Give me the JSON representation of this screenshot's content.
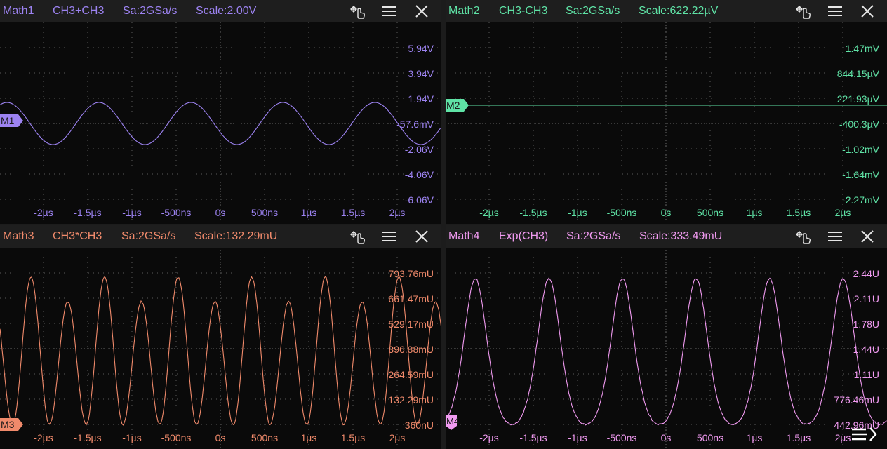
{
  "panels": [
    {
      "id": "m1",
      "name": "Math1",
      "expr": "CH3+CH3",
      "sample": "Sa:2GSa/s",
      "scale": "Scale:2.00V",
      "color": "#9d83f2",
      "marker": "M1",
      "yticks": [
        "5.94V",
        "3.94V",
        "1.94V",
        "-57.6mV",
        "-2.06V",
        "-4.06V",
        "-6.06V"
      ],
      "xticks": [
        "-2µs",
        "-1.5µs",
        "-1µs",
        "-500ns",
        "0s",
        "500ns",
        "1µs",
        "1.5µs",
        "2µs"
      ],
      "waveform": "sine",
      "cycles_on_screen": 4.8
    },
    {
      "id": "m2",
      "name": "Math2",
      "expr": "CH3-CH3",
      "sample": "Sa:2GSa/s",
      "scale": "Scale:622.22µV",
      "color": "#5fe3a6",
      "marker": "M2",
      "yticks": [
        "1.47mV",
        "844.15µV",
        "221.93µV",
        "-400.3µV",
        "-1.02mV",
        "-1.64mV",
        "-2.27mV"
      ],
      "xticks": [
        "-2µs",
        "-1.5µs",
        "-1µs",
        "-500ns",
        "0s",
        "500ns",
        "1µs",
        "1.5µs",
        "2µs"
      ],
      "waveform": "flat"
    },
    {
      "id": "m3",
      "name": "Math3",
      "expr": "CH3*CH3",
      "sample": "Sa:2GSa/s",
      "scale": "Scale:132.29mU",
      "color": "#f08a6b",
      "marker": "M3",
      "yticks": [
        "793.76mU",
        "661.47mU",
        "529.17mU",
        "396.88mU",
        "264.59mU",
        "132.29mU",
        "360nU"
      ],
      "xticks": [
        "-2µs",
        "-1.5µs",
        "-1µs",
        "-500ns",
        "0s",
        "500ns",
        "1µs",
        "1.5µs",
        "2µs"
      ],
      "waveform": "square",
      "cycles_on_screen": 12
    },
    {
      "id": "m4",
      "name": "Math4",
      "expr": "Exp(CH3)",
      "sample": "Sa:2GSa/s",
      "scale": "Scale:333.49mU",
      "color": "#f09af0",
      "marker": "M4",
      "yticks": [
        "2.44U",
        "2.11U",
        "1.78U",
        "1.44U",
        "1.11U",
        "776.46mU",
        "442.96mU"
      ],
      "xticks": [
        "-2µs",
        "-1.5µs",
        "-1µs",
        "-500ns",
        "0s",
        "500ns",
        "1µs",
        "1.5µs",
        "2µs"
      ],
      "waveform": "exp",
      "cycles_on_screen": 6
    }
  ],
  "icons": {
    "touch": "touch-move-icon",
    "menu": "hamburger-menu-icon",
    "close": "close-icon",
    "bottom": "bottom-menu-icon"
  }
}
